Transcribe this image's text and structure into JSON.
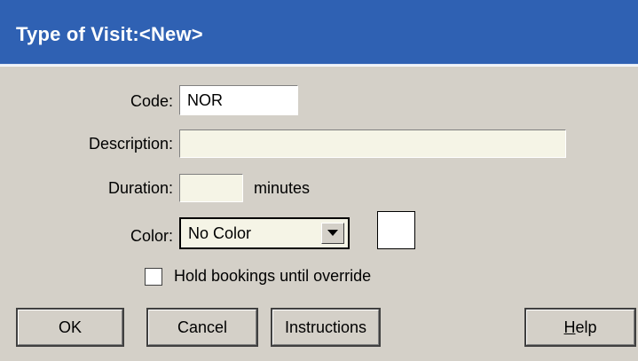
{
  "window": {
    "title": "Type of Visit:<New>"
  },
  "form": {
    "code_label": "Code:",
    "code_value": "NOR",
    "description_label": "Description:",
    "description_value": "",
    "duration_label": "Duration:",
    "duration_value": "",
    "duration_unit": "minutes",
    "color_label": "Color:",
    "color_selected": "No Color",
    "color_swatch": "#ffffff",
    "hold_bookings_label": "Hold bookings until override",
    "hold_bookings_checked": false
  },
  "buttons": {
    "ok": "OK",
    "cancel": "Cancel",
    "instructions": "Instructions",
    "help_before": "",
    "help_mnemonic": "H",
    "help_after": "elp"
  },
  "colors": {
    "title_bar": "#2f61b3",
    "dialog_bg": "#d4d0c8",
    "field_bg": "#f5f4e6"
  },
  "icons": {
    "dropdown": "chevron-down-icon"
  }
}
